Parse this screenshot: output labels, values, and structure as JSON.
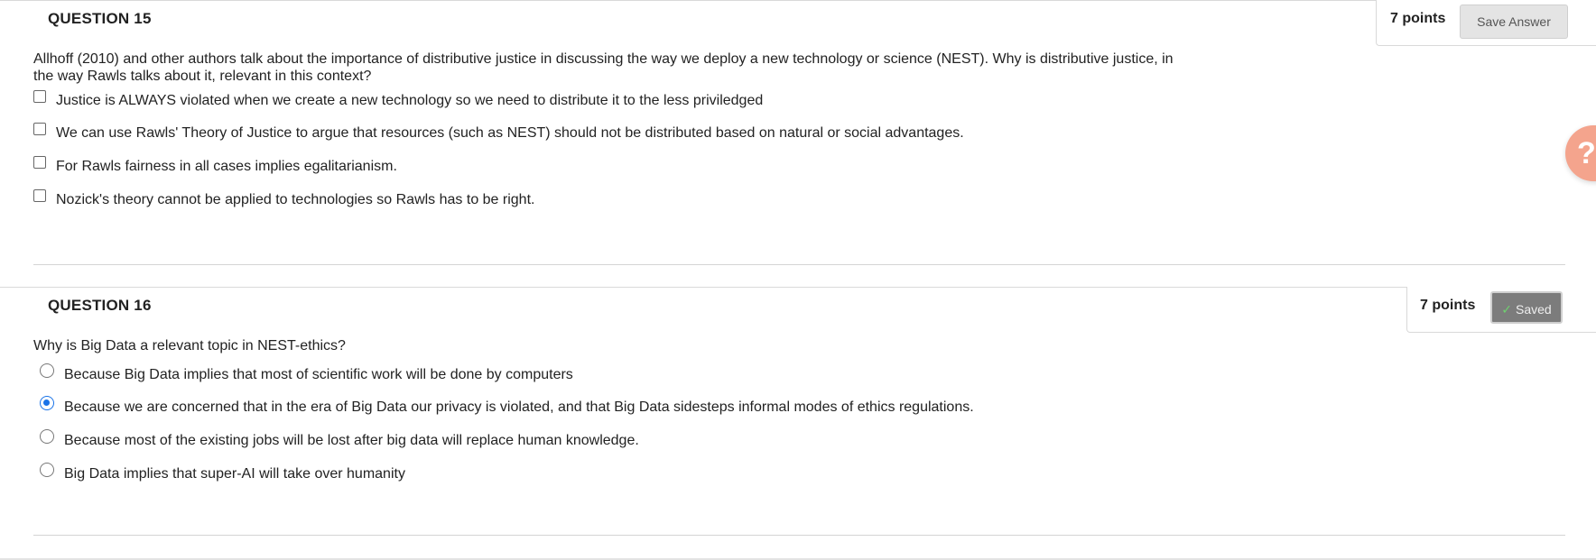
{
  "q15": {
    "title": "QUESTION 15",
    "points": "7 points",
    "save_label": "Save Answer",
    "prompt": "Allhoff (2010) and other authors talk about the importance of distributive justice in discussing the way we deploy a new technology or science (NEST). Why is distributive justice, in the way Rawls talks about it, relevant in this context?",
    "options": [
      {
        "label": "Justice is ALWAYS violated when we create a new technology so we need to distribute it to the less priviledged",
        "checked": false
      },
      {
        "label": "We can use Rawls' Theory of Justice to argue that resources (such as NEST) should not be distributed based on natural or social advantages.",
        "checked": false
      },
      {
        "label": "For Rawls fairness in all cases implies egalitarianism.",
        "checked": false
      },
      {
        "label": "Nozick's theory cannot be applied to technologies so Rawls has to be right.",
        "checked": false
      }
    ]
  },
  "q16": {
    "title": "QUESTION 16",
    "points": "7 points",
    "saved_label": "Saved",
    "prompt": "Why is Big Data a relevant topic in NEST-ethics?",
    "options": [
      {
        "label": "Because Big Data implies that most of scientific work will be done by computers",
        "selected": false
      },
      {
        "label": "Because we are concerned that in the era of Big Data our privacy is violated, and that Big Data sidesteps informal modes of ethics regulations.",
        "selected": true
      },
      {
        "label": "Because most of the existing jobs will be lost after big data will replace human knowledge.",
        "selected": false
      },
      {
        "label": "Big Data implies that super-AI will take over humanity",
        "selected": false
      }
    ]
  },
  "help": {
    "glyph": "?",
    "color": "#f4a48d"
  },
  "colors": {
    "accent": "#1a73e8",
    "saved_bg": "#7c7c7c",
    "check": "#6fd16f"
  }
}
